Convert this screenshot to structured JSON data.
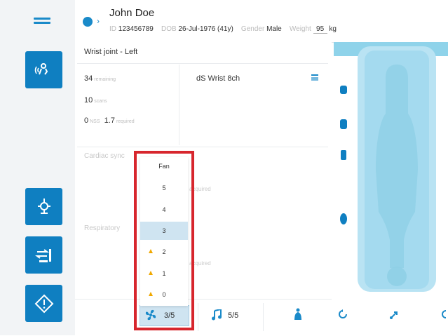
{
  "patient": {
    "name": "John Doe",
    "id_label": "ID",
    "id_value": "123456789",
    "dob_label": "DOB",
    "dob_value": "26-Jul-1976 (41y)",
    "gender_label": "Gender",
    "gender_value": "Male",
    "weight_label": "Weight",
    "weight_value": "95",
    "weight_unit": "kg"
  },
  "panel": {
    "title": "Wrist joint - Left",
    "remaining_value": "34",
    "remaining_label": "remaining",
    "scans_value": "10",
    "scans_label": "scans",
    "a_value": "0",
    "a_label": "NSS",
    "b_value": "1.7",
    "b_label": "required",
    "protocol_name": "dS Wrist 8ch",
    "cardiac_label": "Cardiac sync",
    "respiratory_label": "Respiratory",
    "acquired_1": "acquired",
    "acquired_2": "acquired"
  },
  "fan_menu": {
    "header": "Fan",
    "options": [
      "5",
      "4",
      "3",
      "2",
      "1",
      "0"
    ],
    "selected": "3",
    "warnings": [
      "2",
      "1",
      "0"
    ]
  },
  "bottom": {
    "fan_value": "3/5",
    "music_value": "5/5"
  },
  "colors": {
    "accent": "#0f7fc1",
    "highlight": "#d7262d",
    "selected_bg": "#cfe4f1",
    "warning": "#f0a800",
    "body_view": "#a4daef"
  },
  "icons": {
    "rail": [
      "voice-icon",
      "coil-icon",
      "table-control-icon",
      "diamond-icon"
    ],
    "bottom": [
      "fan-icon",
      "music-icon",
      "patient-icon"
    ],
    "right": [
      "rotate-left-icon",
      "move-icon",
      "rotate-right-icon"
    ]
  }
}
